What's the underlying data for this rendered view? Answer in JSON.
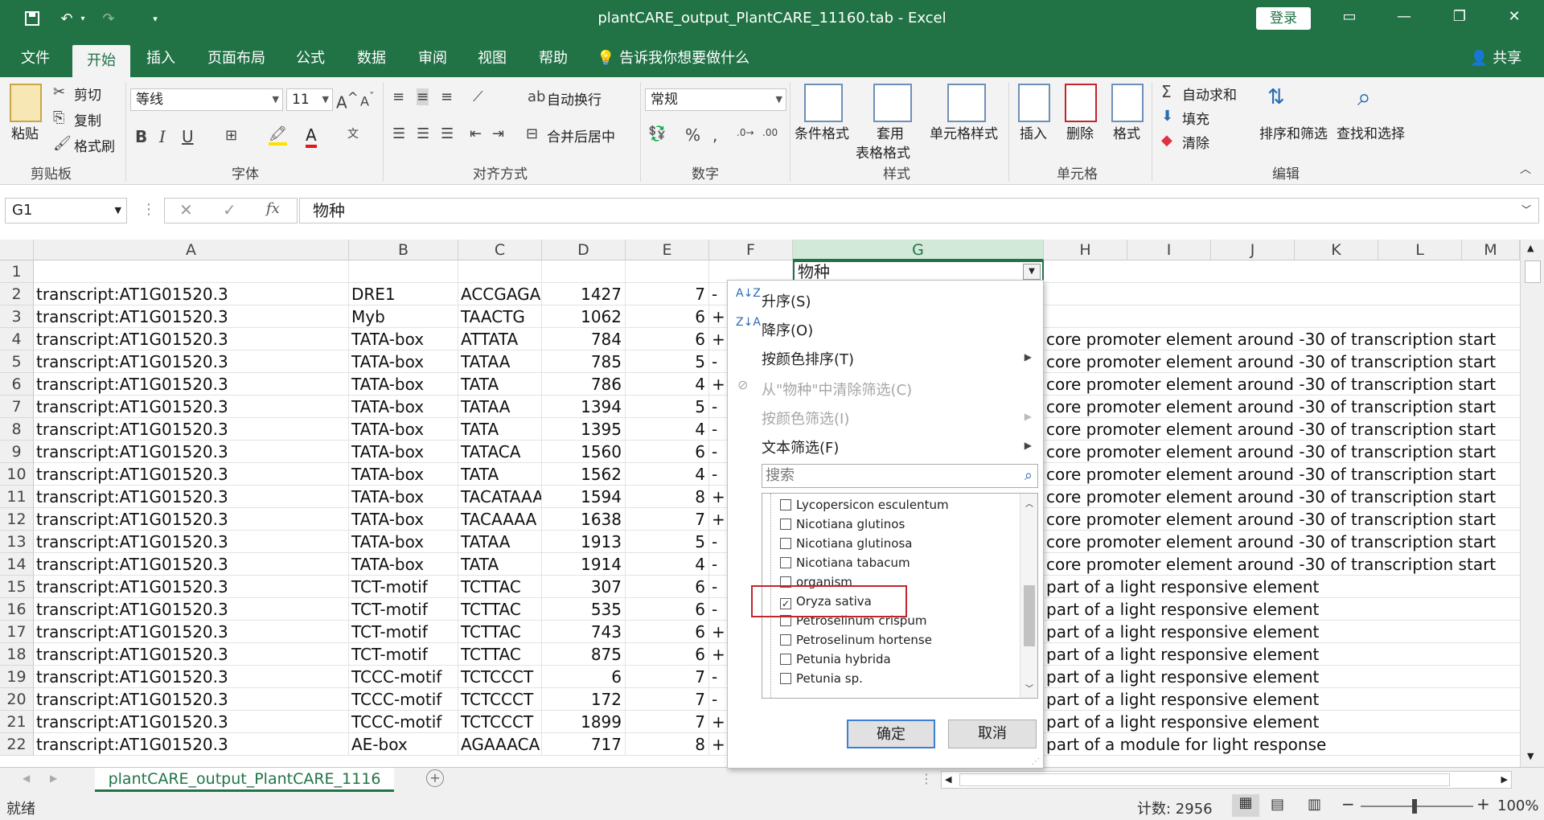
{
  "window": {
    "title": "plantCARE_output_PlantCARE_11160.tab  -  Excel",
    "login": "登录",
    "share": "共享"
  },
  "tabs": [
    "文件",
    "开始",
    "插入",
    "页面布局",
    "公式",
    "数据",
    "审阅",
    "视图",
    "帮助"
  ],
  "tell_me": "告诉我你想要做什么",
  "ribbon": {
    "clipboard": {
      "paste": "粘贴",
      "cut": "剪切",
      "copy": "复制",
      "format_painter": "格式刷",
      "label": "剪贴板"
    },
    "font": {
      "name": "等线",
      "size": "11",
      "label": "字体"
    },
    "alignment": {
      "wrap": "自动换行",
      "merge": "合并后居中",
      "label": "对齐方式"
    },
    "number": {
      "format": "常规",
      "label": "数字"
    },
    "styles": {
      "conditional": "条件格式",
      "table1": "套用",
      "table2": "表格格式",
      "cell_styles": "单元格样式",
      "label": "样式"
    },
    "cells": {
      "insert": "插入",
      "delete": "删除",
      "format": "格式",
      "label": "单元格"
    },
    "editing": {
      "autosum": "自动求和",
      "fill": "填充",
      "clear": "清除",
      "sort_filter": "排序和筛选",
      "find_select": "查找和选择",
      "label": "编辑"
    }
  },
  "formula_bar": {
    "name_box": "G1",
    "content": "物种",
    "fx": "fx"
  },
  "columns": [
    "A",
    "B",
    "C",
    "D",
    "E",
    "F",
    "G",
    "H",
    "I",
    "J",
    "K",
    "L",
    "M"
  ],
  "g1_value": "物种",
  "rows": [
    {
      "n": "1",
      "a": "",
      "b": "",
      "c": "",
      "d": "",
      "e": "",
      "f": "",
      "h": ""
    },
    {
      "n": "2",
      "a": "transcript:AT1G01520.3",
      "b": "DRE1",
      "c": "ACCGAGA",
      "d": "1427",
      "e": "7",
      "f": "-",
      "h": ""
    },
    {
      "n": "3",
      "a": "transcript:AT1G01520.3",
      "b": "Myb",
      "c": "TAACTG",
      "d": "1062",
      "e": "6",
      "f": "+",
      "h": ""
    },
    {
      "n": "4",
      "a": "transcript:AT1G01520.3",
      "b": "TATA-box",
      "c": "ATTATA",
      "d": "784",
      "e": "6",
      "f": "+",
      "h": "core promoter element around -30 of transcription start"
    },
    {
      "n": "5",
      "a": "transcript:AT1G01520.3",
      "b": "TATA-box",
      "c": "TATAA",
      "d": "785",
      "e": "5",
      "f": "-",
      "h": "core promoter element around -30 of transcription start"
    },
    {
      "n": "6",
      "a": "transcript:AT1G01520.3",
      "b": "TATA-box",
      "c": "TATA",
      "d": "786",
      "e": "4",
      "f": "+",
      "h": "core promoter element around -30 of transcription start"
    },
    {
      "n": "7",
      "a": "transcript:AT1G01520.3",
      "b": "TATA-box",
      "c": "TATAA",
      "d": "1394",
      "e": "5",
      "f": "-",
      "h": "core promoter element around -30 of transcription start"
    },
    {
      "n": "8",
      "a": "transcript:AT1G01520.3",
      "b": "TATA-box",
      "c": "TATA",
      "d": "1395",
      "e": "4",
      "f": "-",
      "h": "core promoter element around -30 of transcription start"
    },
    {
      "n": "9",
      "a": "transcript:AT1G01520.3",
      "b": "TATA-box",
      "c": "TATACA",
      "d": "1560",
      "e": "6",
      "f": "-",
      "h": "core promoter element around -30 of transcription start"
    },
    {
      "n": "10",
      "a": "transcript:AT1G01520.3",
      "b": "TATA-box",
      "c": "TATA",
      "d": "1562",
      "e": "4",
      "f": "-",
      "h": "core promoter element around -30 of transcription start"
    },
    {
      "n": "11",
      "a": "transcript:AT1G01520.3",
      "b": "TATA-box",
      "c": "TACATAAA",
      "d": "1594",
      "e": "8",
      "f": "+",
      "h": "core promoter element around -30 of transcription start"
    },
    {
      "n": "12",
      "a": "transcript:AT1G01520.3",
      "b": "TATA-box",
      "c": "TACAAAA",
      "d": "1638",
      "e": "7",
      "f": "+",
      "h": "core promoter element around -30 of transcription start"
    },
    {
      "n": "13",
      "a": "transcript:AT1G01520.3",
      "b": "TATA-box",
      "c": "TATAA",
      "d": "1913",
      "e": "5",
      "f": "-",
      "h": "core promoter element around -30 of transcription start"
    },
    {
      "n": "14",
      "a": "transcript:AT1G01520.3",
      "b": "TATA-box",
      "c": "TATA",
      "d": "1914",
      "e": "4",
      "f": "-",
      "h": "core promoter element around -30 of transcription start"
    },
    {
      "n": "15",
      "a": "transcript:AT1G01520.3",
      "b": "TCT-motif",
      "c": "TCTTAC",
      "d": "307",
      "e": "6",
      "f": "-",
      "h": "part of a light responsive element"
    },
    {
      "n": "16",
      "a": "transcript:AT1G01520.3",
      "b": "TCT-motif",
      "c": "TCTTAC",
      "d": "535",
      "e": "6",
      "f": "-",
      "h": "part of a light responsive element"
    },
    {
      "n": "17",
      "a": "transcript:AT1G01520.3",
      "b": "TCT-motif",
      "c": "TCTTAC",
      "d": "743",
      "e": "6",
      "f": "+",
      "h": "part of a light responsive element"
    },
    {
      "n": "18",
      "a": "transcript:AT1G01520.3",
      "b": "TCT-motif",
      "c": "TCTTAC",
      "d": "875",
      "e": "6",
      "f": "+",
      "h": "part of a light responsive element"
    },
    {
      "n": "19",
      "a": "transcript:AT1G01520.3",
      "b": "TCCC-motif",
      "c": "TCTCCCT",
      "d": "6",
      "e": "7",
      "f": "-",
      "h": "part of a light responsive element"
    },
    {
      "n": "20",
      "a": "transcript:AT1G01520.3",
      "b": "TCCC-motif",
      "c": "TCTCCCT",
      "d": "172",
      "e": "7",
      "f": "-",
      "h": "part of a light responsive element"
    },
    {
      "n": "21",
      "a": "transcript:AT1G01520.3",
      "b": "TCCC-motif",
      "c": "TCTCCCT",
      "d": "1899",
      "e": "7",
      "f": "+",
      "h": "part of a light responsive element"
    },
    {
      "n": "22",
      "a": "transcript:AT1G01520.3",
      "b": "AE-box",
      "c": "AGAAACA",
      "d": "717",
      "e": "8",
      "f": "+",
      "h": "part of a module for light response"
    }
  ],
  "filter": {
    "sort_asc": "升序(S)",
    "sort_desc": "降序(O)",
    "sort_color": "按颜色排序(T)",
    "clear": "从\"物种\"中清除筛选(C)",
    "filter_color": "按颜色筛选(I)",
    "text_filter": "文本筛选(F)",
    "search_placeholder": "搜索",
    "items": [
      {
        "label": "Lycopersicon esculentum",
        "checked": false
      },
      {
        "label": "Nicotiana glutinos",
        "checked": false
      },
      {
        "label": "Nicotiana glutinosa",
        "checked": false
      },
      {
        "label": "Nicotiana tabacum",
        "checked": false
      },
      {
        "label": "organism",
        "checked": false
      },
      {
        "label": "Oryza sativa",
        "checked": true
      },
      {
        "label": "Petroselinum crispum",
        "checked": false
      },
      {
        "label": "Petroselinum hortense",
        "checked": false
      },
      {
        "label": "Petunia hybrida",
        "checked": false
      },
      {
        "label": "Petunia sp.",
        "checked": false
      }
    ],
    "ok": "确定",
    "cancel": "取消"
  },
  "sheet": {
    "tab_name": "plantCARE_output_PlantCARE_1116"
  },
  "status": {
    "ready": "就绪",
    "count": "计数: 2956",
    "zoom": "100%"
  },
  "colors": {
    "excel_green": "#217346",
    "highlight_red": "#c0262d"
  }
}
